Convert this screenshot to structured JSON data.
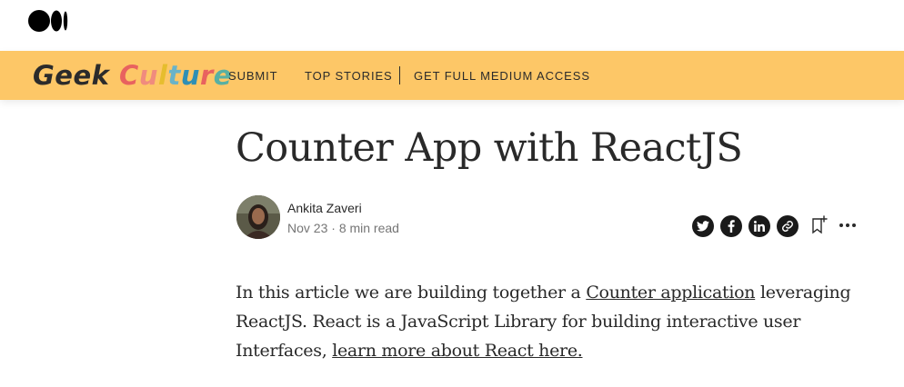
{
  "publication": {
    "logo_word1": "Geek",
    "logo_word2_letters": [
      "C",
      "u",
      "l",
      "t",
      "u",
      "r",
      "e"
    ],
    "nav": [
      "SUBMIT",
      "TOP STORIES",
      "GET FULL MEDIUM ACCESS"
    ]
  },
  "article": {
    "title": "Counter App with ReactJS",
    "author": "Ankita Zaveri",
    "date": "Nov 23",
    "separator": "·",
    "read_time": "8 min read",
    "paragraph": {
      "text1": "In this article we are building together a ",
      "link1": "Counter application",
      "text2": " leveraging ReactJS. React is a JavaScript Library for building interactive user Interfaces, ",
      "link2": "learn more about React here."
    }
  },
  "icons": [
    "medium-logo-icon",
    "twitter-icon",
    "facebook-icon",
    "linkedin-icon",
    "link-icon",
    "bookmark-add-icon",
    "more-icon"
  ],
  "colors": {
    "publication_bar": "#fdc767",
    "text": "#292929",
    "meta": "#757575"
  }
}
